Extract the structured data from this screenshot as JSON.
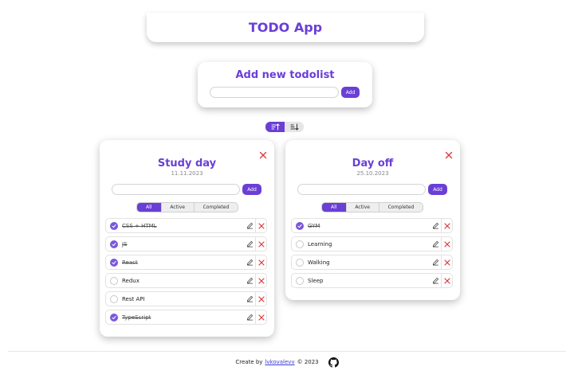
{
  "header": {
    "title": "TODO App"
  },
  "add_list": {
    "heading": "Add new todolist",
    "input_value": "",
    "button_label": "Add"
  },
  "sort": {
    "active": "descending"
  },
  "colors": {
    "accent": "#6a3fd6",
    "danger": "#e0393e"
  },
  "lists": [
    {
      "title": "Study day",
      "date": "11.11.2023",
      "input_value": "",
      "add_label": "Add",
      "filters": [
        "All",
        "Active",
        "Completed"
      ],
      "active_filter": "All",
      "tasks": [
        {
          "text": "CSS + HTML",
          "done": true
        },
        {
          "text": "JS",
          "done": true
        },
        {
          "text": "React",
          "done": true
        },
        {
          "text": "Redux",
          "done": false
        },
        {
          "text": "Rest API",
          "done": false
        },
        {
          "text": "TypeScript",
          "done": true
        }
      ]
    },
    {
      "title": "Day off",
      "date": "25.10.2023",
      "input_value": "",
      "add_label": "Add",
      "filters": [
        "All",
        "Active",
        "Completed"
      ],
      "active_filter": "All",
      "tasks": [
        {
          "text": "GYM",
          "done": true
        },
        {
          "text": "Learning",
          "done": false
        },
        {
          "text": "Walking",
          "done": false
        },
        {
          "text": "Sleep",
          "done": false
        }
      ]
    }
  ],
  "footer": {
    "prefix": "Create by",
    "author": "lvkovalevv",
    "suffix": "© 2023"
  }
}
